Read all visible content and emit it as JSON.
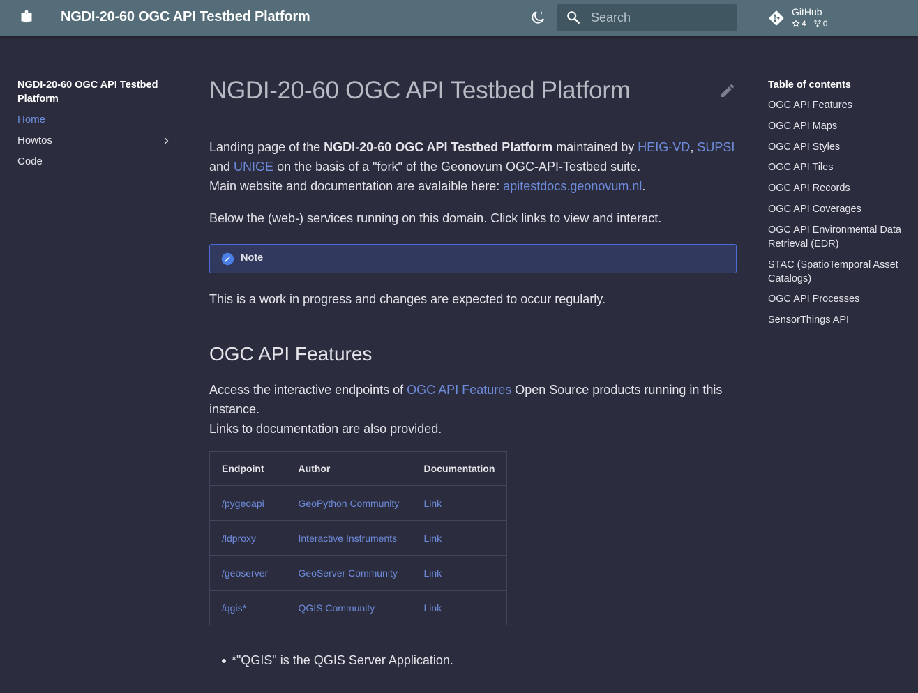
{
  "header": {
    "site_title": "NGDI-20-60 OGC API Testbed Platform",
    "search_placeholder": "Search",
    "repo": {
      "name": "GitHub",
      "stars": "4",
      "forks": "0"
    }
  },
  "nav": {
    "title": "NGDI-20-60 OGC API Testbed Platform",
    "items": [
      {
        "label": "Home"
      },
      {
        "label": "Howtos"
      },
      {
        "label": "Code"
      }
    ]
  },
  "main": {
    "title": "NGDI-20-60 OGC API Testbed Platform",
    "intro": {
      "t1": "Landing page of the ",
      "strong": "NGDI-20-60 OGC API Testbed Platform",
      "t2": " maintained by ",
      "link1": "HEIG-VD",
      "sep1": ", ",
      "link2": "SUPSI",
      "t3": " and ",
      "link3": "UNIGE",
      "t4": " on the basis of a \"fork\" of the Geonovum OGC-API-Testbed suite.",
      "t5": "Main website and documentation are avalaible here: ",
      "link4": "apitestdocs.geonovum.nl",
      "t6": "."
    },
    "services_text": "Below the (web-) services running on this domain. Click links to view and interact.",
    "note_title": "Note",
    "wip_text": "This is a work in progress and changes are expected to occur regularly.",
    "section_heading": "OGC API Features",
    "section_intro": {
      "t1": "Access the interactive endpoints of ",
      "link": "OGC API Features",
      "t2": " Open Source products running in this instance.",
      "t3": "Links to documentation are also provided."
    },
    "table": {
      "headers": [
        "Endpoint",
        "Author",
        "Documentation"
      ],
      "rows": [
        [
          "/pygeoapi",
          "GeoPython Community",
          "Link"
        ],
        [
          "/ldproxy",
          "Interactive Instruments",
          "Link"
        ],
        [
          "/geoserver",
          "GeoServer Community",
          "Link"
        ],
        [
          "/qgis*",
          "QGIS Community",
          "Link"
        ]
      ]
    },
    "footnote": "*\"QGIS\" is the QGIS Server Application."
  },
  "toc": {
    "title": "Table of contents",
    "items": [
      "OGC API Features",
      "OGC API Maps",
      "OGC API Styles",
      "OGC API Tiles",
      "OGC API Records",
      "OGC API Coverages",
      "OGC API Environmental Data Retrieval (EDR)",
      "STAC (SpatioTemporal Asset Catalogs)",
      "OGC API Processes",
      "SensorThings API"
    ]
  },
  "colors": {
    "header_bg": "#546d78",
    "page_bg": "#2b2d3e",
    "link": "#6e8bdb",
    "note_border": "#4a6bd8"
  }
}
